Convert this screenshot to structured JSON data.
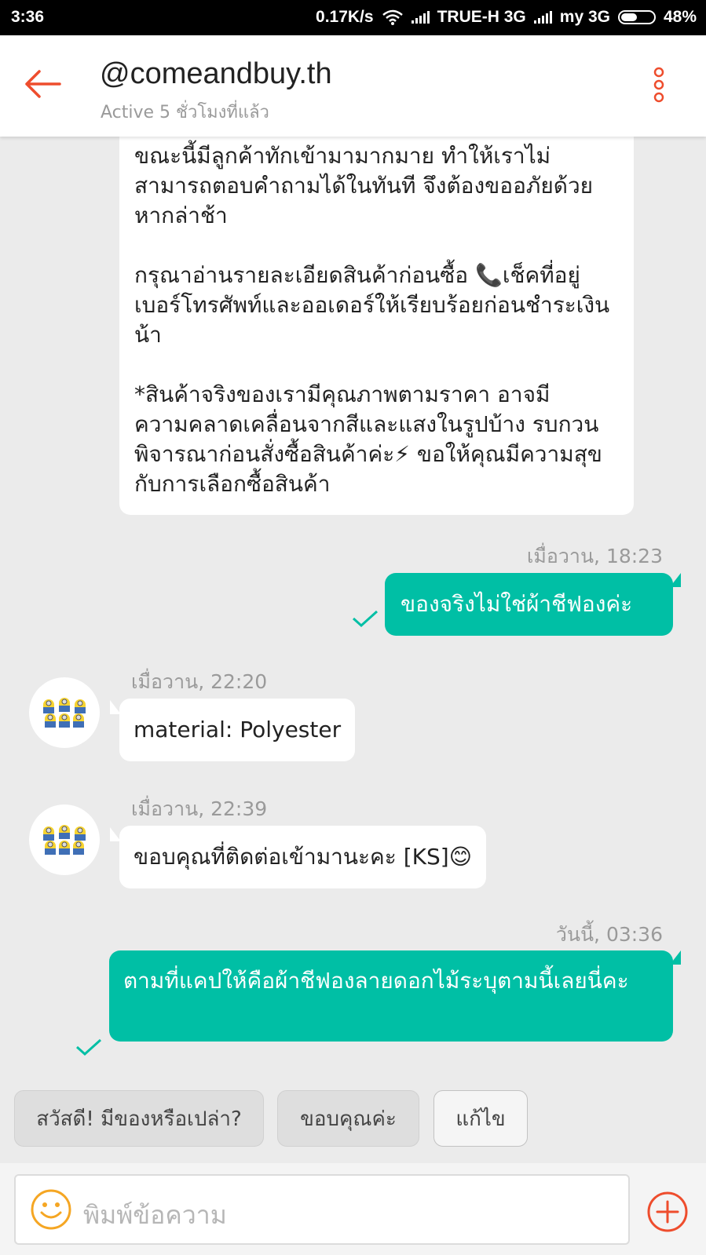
{
  "status_bar": {
    "time": "3:36",
    "speed": "0.17K/s",
    "carrier1": "TRUE-H 3G",
    "carrier2": "my 3G",
    "battery": "48%"
  },
  "header": {
    "title": "@comeandbuy.th",
    "subtitle": "Active 5 ชั่วโมงที่แล้ว",
    "accent_color": "#ee4d2d"
  },
  "messages": [
    {
      "side": "in",
      "paragraphs": [
        "ขณะนี้มีลูกค้าทักเข้ามามากมาย ทำให้เราไม่สามารถตอบคำถามได้ในทันที จึงต้องขออภัยด้วยหากล่าช้า",
        "กรุณาอ่านรายละเอียดสินค้าก่อนซื้อ 📞เช็คที่อยู่เบอร์โทรศัพท์และออเดอร์ให้เรียบร้อยก่อนชำระเงินน้า",
        "*สินค้าจริงของเรามีคุณภาพตามราคา อาจมีความคลาดเคลื่อนจากสีและแสงในรูปบ้าง รบกวนพิจารณาก่อนสั่งซื้อสินค้าค่ะ⚡ ขอให้คุณมีความสุขกับการเลือกซื้อสินค้า"
      ]
    },
    {
      "side": "out",
      "time": "เมื่อวาน, 18:23",
      "text": "ของจริงไม่ใช่ผ้าชีฟองค่ะ"
    },
    {
      "side": "in",
      "time": "เมื่อวาน, 22:20",
      "text": "material: Polyester"
    },
    {
      "side": "in",
      "time": "เมื่อวาน, 22:39",
      "text": "ขอบคุณที่ติดต่อเข้ามานะคะ [KS]😊"
    },
    {
      "side": "out",
      "time": "วันนี้, 03:36",
      "text": "ตามที่แคปให้คือผ้าชีฟองลายดอกไม้ระบุตามนี้เลยนี่คะ"
    }
  ],
  "quick_replies": [
    "สวัสดี! มีของหรือเปล่า?",
    "ขอบคุณค่ะ",
    "แก้ไข"
  ],
  "input": {
    "placeholder": "พิมพ์ข้อความ"
  },
  "colors": {
    "outgoing": "#00bfa5",
    "incoming": "#ffffff",
    "background": "#ebebeb",
    "tick": "#00bfa5"
  }
}
